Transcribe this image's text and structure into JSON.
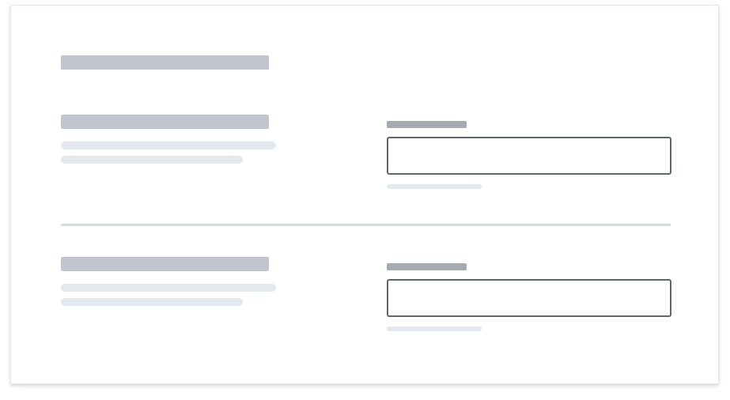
{
  "colors": {
    "skeleton_heading": "#c0c5cf",
    "skeleton_text": "#e4e8ef",
    "skeleton_label": "#a6aab1",
    "input_border": "#5f6670",
    "divider": "#d6dbe3"
  },
  "form": {
    "sections": [
      {
        "input_value": "",
        "placeholder": ""
      },
      {
        "input_value": "",
        "placeholder": ""
      }
    ]
  }
}
